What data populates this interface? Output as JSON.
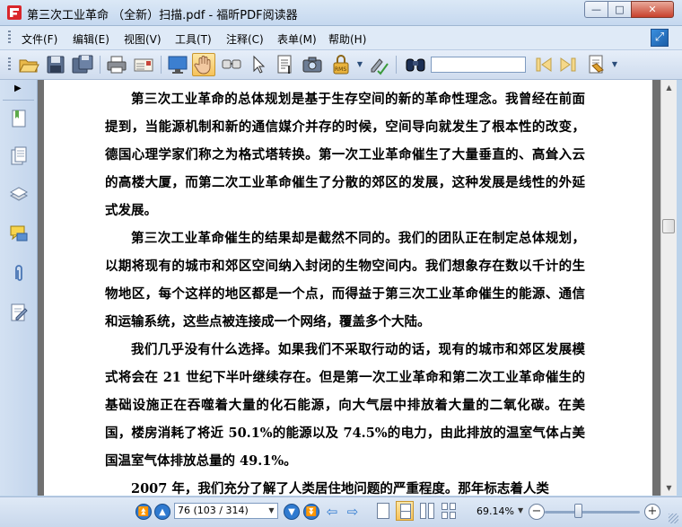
{
  "window": {
    "title": "第三次工业革命 （全新）扫描.pdf - 福昕PDF阅读器",
    "minimize": "—",
    "maximize": "□",
    "close": "✕"
  },
  "menubar": {
    "items": [
      "文件(F)",
      "编辑(E)",
      "视图(V)",
      "工具(T)",
      "注释(C)",
      "表单(M)",
      "帮助(H)"
    ]
  },
  "toolbar": {
    "buttons": [
      "open-icon",
      "save-icon",
      "save-as-icon",
      "print-icon",
      "email-icon",
      "fullscreen-icon",
      "hand-tool-icon",
      "zoom-tool-icon",
      "select-tool-icon",
      "text-select-icon",
      "snapshot-icon",
      "rms-icon",
      "sign-icon",
      "find-icon"
    ],
    "rms_label": "RMS",
    "find_value": ""
  },
  "document": {
    "paragraphs": [
      "第三次工业革命的总体规划是基于生存空间的新的革命性理念。我曾经在前面提到，当能源机制和新的通信媒介并存的时候，空间导向就发生了根本性的改变，德国心理学家们称之为格式塔转换。第一次工业革命催生了大量垂直的、高耸入云的高楼大厦，而第二次工业革命催生了分散的郊区的发展，这种发展是线性的外延式发展。",
      "第三次工业革命催生的结果却是截然不同的。我们的团队正在制定总体规划，以期将现有的城市和郊区空间纳入封闭的生物空间内。我们想象存在数以千计的生物地区，每个这样的地区都是一个点，而得益于第三次工业革命催生的能源、通信和运输系统，这些点被连接成一个网络，覆盖多个大陆。",
      "我们几乎没有什么选择。如果我们不采取行动的话，现有的城市和郊区发展模式将会在 21 世纪下半叶继续存在。但是第一次工业革命和第二次工业革命催生的基础设施正在吞噬着大量的化石能源，向大气层中排放着大量的二氧化碳。在美国，楼房消耗了将近 50.1%的能源以及 74.5%的电力，由此排放的温室气体占美国温室气体排放总量的 49.1%。",
      "2007 年，我们充分了解了人类居住地问题的严重程度。那年标志着人类"
    ]
  },
  "statusbar": {
    "page_field": "76 (103 / 314)",
    "zoom": "69.14%",
    "zoom_level_fraction": 0.35
  }
}
